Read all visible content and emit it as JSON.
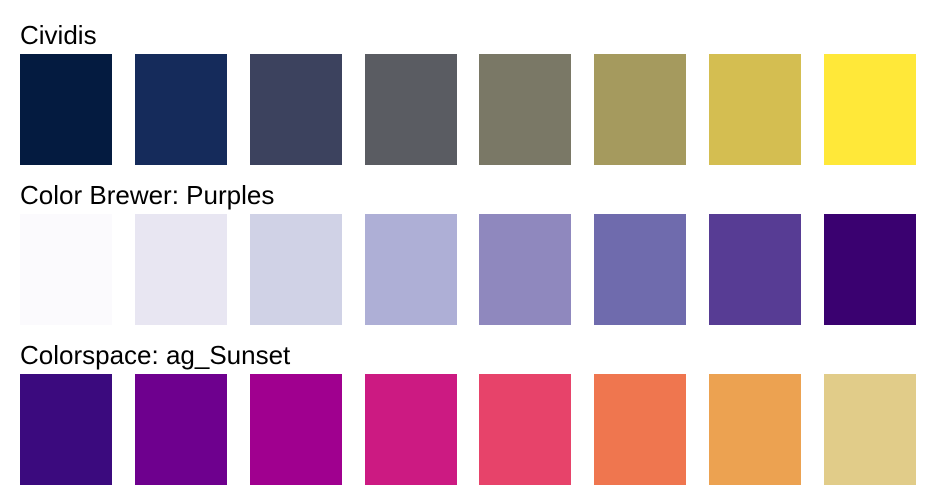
{
  "palettes": [
    {
      "title": "Cividis",
      "colors": [
        "#041B40",
        "#152B5B",
        "#3C425E",
        "#5A5C62",
        "#7A7866",
        "#A59A5E",
        "#D4BE51",
        "#FFE839"
      ]
    },
    {
      "title": "Color Brewer: Purples",
      "colors": [
        "#FBFAFD",
        "#E8E6F2",
        "#D0D2E6",
        "#AEAFD6",
        "#8F88BE",
        "#6F6BAD",
        "#573C94",
        "#3A0170"
      ]
    },
    {
      "title": "Colorspace: ag_Sunset",
      "colors": [
        "#3B0A7E",
        "#6E008E",
        "#A0008F",
        "#CC1A82",
        "#E7436A",
        "#EF764F",
        "#ECA251",
        "#E1CC89"
      ]
    }
  ]
}
